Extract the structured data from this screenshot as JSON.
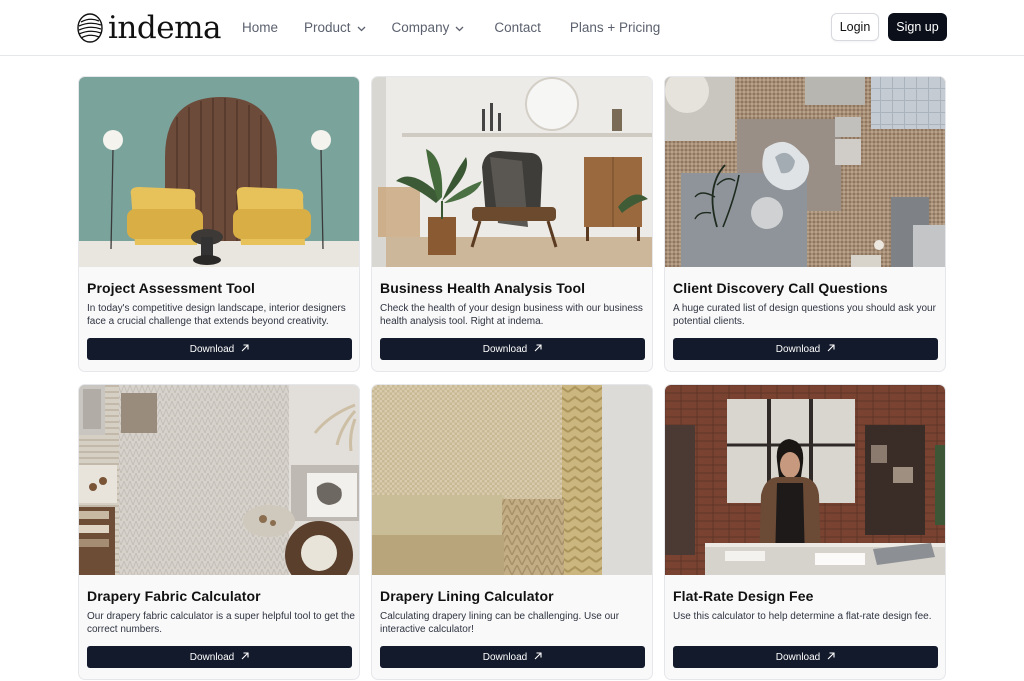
{
  "header": {
    "logo_text": "indema",
    "nav": [
      {
        "label": "Home",
        "has_dropdown": false
      },
      {
        "label": "Product",
        "has_dropdown": true
      },
      {
        "label": "Company",
        "has_dropdown": true
      },
      {
        "label": "Contact",
        "has_dropdown": false
      },
      {
        "label": "Plans + Pricing",
        "has_dropdown": false
      }
    ],
    "login_label": "Login",
    "signup_label": "Sign up"
  },
  "cards": [
    {
      "title": "Project Assessment Tool",
      "description": "In today's competitive design landscape, interior designers face a crucial challenge that extends beyond creativity.",
      "button_label": "Download",
      "image": "interior-arch-yellow-chairs"
    },
    {
      "title": "Business Health Analysis Tool",
      "description": "Check the health of your design business with our business health analysis tool. Right at indema.",
      "button_label": "Download",
      "image": "living-room-armchair-plants"
    },
    {
      "title": "Client Discovery Call Questions",
      "description": "A huge curated list of design questions you should ask your potential clients.",
      "button_label": "Download",
      "image": "material-samples-flatlay"
    },
    {
      "title": "Drapery Fabric Calculator",
      "description": "Our drapery fabric calculator is a super helpful tool to get the correct numbers.",
      "button_label": "Download",
      "image": "textile-swatches-flatlay"
    },
    {
      "title": "Drapery Lining Calculator",
      "description": "Calculating drapery lining can be challenging. Use our interactive calculator!",
      "button_label": "Download",
      "image": "fabric-swatches-beige"
    },
    {
      "title": "Flat-Rate Design Fee",
      "description": "Use this calculator to help determine a flat-rate design fee.",
      "button_label": "Download",
      "image": "designer-in-studio"
    }
  ],
  "colors": {
    "button_dark": "#131a2b",
    "signup_bg": "#0b0f19",
    "nav_text": "#5b616e",
    "card_bg": "#f9f9fa"
  },
  "icons": {
    "nav_dropdown": "chevron-down-icon",
    "download_button": "arrow-up-right-icon",
    "logo": "indema-logo-icon"
  }
}
